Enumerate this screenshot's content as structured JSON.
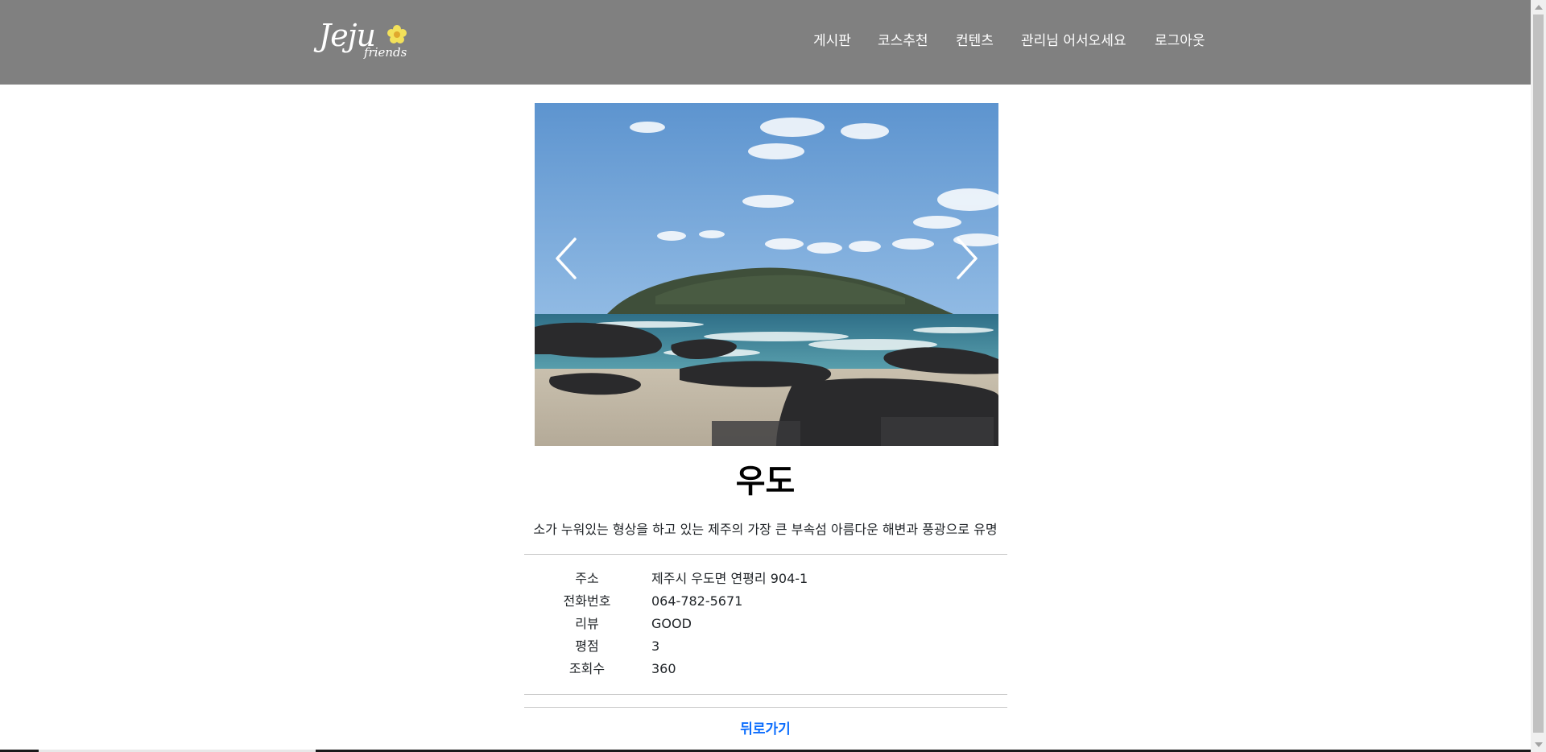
{
  "header": {
    "logo_text": "Jeju",
    "logo_sub": "friends",
    "background": "#808080",
    "nav": [
      {
        "label": "게시판"
      },
      {
        "label": "코스추천"
      },
      {
        "label": "컨텐츠"
      },
      {
        "label": "관리님 어서오세요"
      },
      {
        "label": "로그아웃"
      }
    ]
  },
  "carousel": {
    "prev_icon": "chevron-left-icon",
    "next_icon": "chevron-right-icon"
  },
  "place": {
    "title": "우도",
    "description": "소가 누워있는 형상을 하고 있는 제주의 가장 큰 부속섬 아름다운 해변과 풍광으로 유명",
    "info": [
      {
        "label": "주소",
        "value": "제주시 우도면 연평리 904-1"
      },
      {
        "label": "전화번호",
        "value": "064-782-5671"
      },
      {
        "label": "리뷰",
        "value": "GOOD"
      },
      {
        "label": "평점",
        "value": "3"
      },
      {
        "label": "조회수",
        "value": "360"
      }
    ]
  },
  "actions": {
    "back_label": "뒤로가기",
    "link_color": "#0d6efd"
  }
}
